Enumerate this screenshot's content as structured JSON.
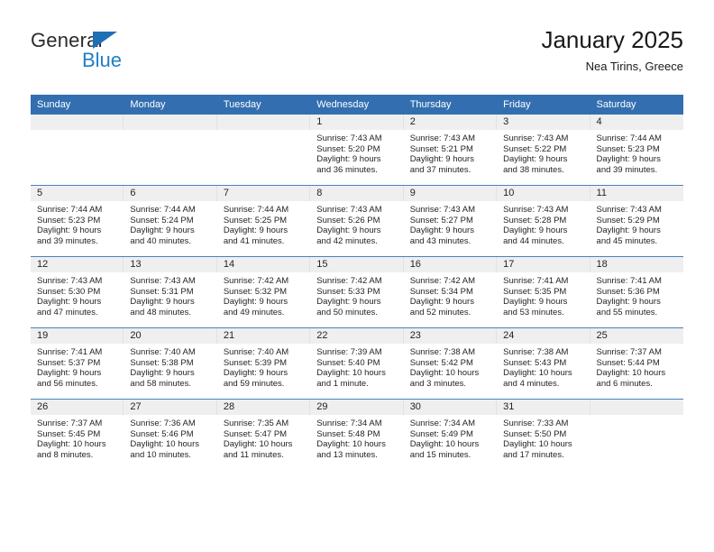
{
  "brand": {
    "name_part1": "General",
    "name_part2": "Blue",
    "triangle_color": "#1f6fb4",
    "blue_color": "#1f7fc4"
  },
  "header": {
    "title": "January 2025",
    "subtitle": "Nea Tirins, Greece"
  },
  "theme": {
    "header_blue": "#336fb0",
    "row_rule_blue": "#4a82bd",
    "day_strip_gray": "#efefef"
  },
  "weekday_headers": [
    "Sunday",
    "Monday",
    "Tuesday",
    "Wednesday",
    "Thursday",
    "Friday",
    "Saturday"
  ],
  "labels": {
    "sunrise_prefix": "Sunrise:",
    "sunset_prefix": "Sunset:",
    "daylight_prefix": "Daylight:"
  },
  "weeks": [
    [
      {
        "day": "",
        "empty": true
      },
      {
        "day": "",
        "empty": true
      },
      {
        "day": "",
        "empty": true
      },
      {
        "day": "1",
        "sunrise": "Sunrise: 7:43 AM",
        "sunset": "Sunset: 5:20 PM",
        "daylight_line1": "Daylight: 9 hours",
        "daylight_line2": "and 36 minutes."
      },
      {
        "day": "2",
        "sunrise": "Sunrise: 7:43 AM",
        "sunset": "Sunset: 5:21 PM",
        "daylight_line1": "Daylight: 9 hours",
        "daylight_line2": "and 37 minutes."
      },
      {
        "day": "3",
        "sunrise": "Sunrise: 7:43 AM",
        "sunset": "Sunset: 5:22 PM",
        "daylight_line1": "Daylight: 9 hours",
        "daylight_line2": "and 38 minutes."
      },
      {
        "day": "4",
        "sunrise": "Sunrise: 7:44 AM",
        "sunset": "Sunset: 5:23 PM",
        "daylight_line1": "Daylight: 9 hours",
        "daylight_line2": "and 39 minutes."
      }
    ],
    [
      {
        "day": "5",
        "sunrise": "Sunrise: 7:44 AM",
        "sunset": "Sunset: 5:23 PM",
        "daylight_line1": "Daylight: 9 hours",
        "daylight_line2": "and 39 minutes."
      },
      {
        "day": "6",
        "sunrise": "Sunrise: 7:44 AM",
        "sunset": "Sunset: 5:24 PM",
        "daylight_line1": "Daylight: 9 hours",
        "daylight_line2": "and 40 minutes."
      },
      {
        "day": "7",
        "sunrise": "Sunrise: 7:44 AM",
        "sunset": "Sunset: 5:25 PM",
        "daylight_line1": "Daylight: 9 hours",
        "daylight_line2": "and 41 minutes."
      },
      {
        "day": "8",
        "sunrise": "Sunrise: 7:43 AM",
        "sunset": "Sunset: 5:26 PM",
        "daylight_line1": "Daylight: 9 hours",
        "daylight_line2": "and 42 minutes."
      },
      {
        "day": "9",
        "sunrise": "Sunrise: 7:43 AM",
        "sunset": "Sunset: 5:27 PM",
        "daylight_line1": "Daylight: 9 hours",
        "daylight_line2": "and 43 minutes."
      },
      {
        "day": "10",
        "sunrise": "Sunrise: 7:43 AM",
        "sunset": "Sunset: 5:28 PM",
        "daylight_line1": "Daylight: 9 hours",
        "daylight_line2": "and 44 minutes."
      },
      {
        "day": "11",
        "sunrise": "Sunrise: 7:43 AM",
        "sunset": "Sunset: 5:29 PM",
        "daylight_line1": "Daylight: 9 hours",
        "daylight_line2": "and 45 minutes."
      }
    ],
    [
      {
        "day": "12",
        "sunrise": "Sunrise: 7:43 AM",
        "sunset": "Sunset: 5:30 PM",
        "daylight_line1": "Daylight: 9 hours",
        "daylight_line2": "and 47 minutes."
      },
      {
        "day": "13",
        "sunrise": "Sunrise: 7:43 AM",
        "sunset": "Sunset: 5:31 PM",
        "daylight_line1": "Daylight: 9 hours",
        "daylight_line2": "and 48 minutes."
      },
      {
        "day": "14",
        "sunrise": "Sunrise: 7:42 AM",
        "sunset": "Sunset: 5:32 PM",
        "daylight_line1": "Daylight: 9 hours",
        "daylight_line2": "and 49 minutes."
      },
      {
        "day": "15",
        "sunrise": "Sunrise: 7:42 AM",
        "sunset": "Sunset: 5:33 PM",
        "daylight_line1": "Daylight: 9 hours",
        "daylight_line2": "and 50 minutes."
      },
      {
        "day": "16",
        "sunrise": "Sunrise: 7:42 AM",
        "sunset": "Sunset: 5:34 PM",
        "daylight_line1": "Daylight: 9 hours",
        "daylight_line2": "and 52 minutes."
      },
      {
        "day": "17",
        "sunrise": "Sunrise: 7:41 AM",
        "sunset": "Sunset: 5:35 PM",
        "daylight_line1": "Daylight: 9 hours",
        "daylight_line2": "and 53 minutes."
      },
      {
        "day": "18",
        "sunrise": "Sunrise: 7:41 AM",
        "sunset": "Sunset: 5:36 PM",
        "daylight_line1": "Daylight: 9 hours",
        "daylight_line2": "and 55 minutes."
      }
    ],
    [
      {
        "day": "19",
        "sunrise": "Sunrise: 7:41 AM",
        "sunset": "Sunset: 5:37 PM",
        "daylight_line1": "Daylight: 9 hours",
        "daylight_line2": "and 56 minutes."
      },
      {
        "day": "20",
        "sunrise": "Sunrise: 7:40 AM",
        "sunset": "Sunset: 5:38 PM",
        "daylight_line1": "Daylight: 9 hours",
        "daylight_line2": "and 58 minutes."
      },
      {
        "day": "21",
        "sunrise": "Sunrise: 7:40 AM",
        "sunset": "Sunset: 5:39 PM",
        "daylight_line1": "Daylight: 9 hours",
        "daylight_line2": "and 59 minutes."
      },
      {
        "day": "22",
        "sunrise": "Sunrise: 7:39 AM",
        "sunset": "Sunset: 5:40 PM",
        "daylight_line1": "Daylight: 10 hours",
        "daylight_line2": "and 1 minute."
      },
      {
        "day": "23",
        "sunrise": "Sunrise: 7:38 AM",
        "sunset": "Sunset: 5:42 PM",
        "daylight_line1": "Daylight: 10 hours",
        "daylight_line2": "and 3 minutes."
      },
      {
        "day": "24",
        "sunrise": "Sunrise: 7:38 AM",
        "sunset": "Sunset: 5:43 PM",
        "daylight_line1": "Daylight: 10 hours",
        "daylight_line2": "and 4 minutes."
      },
      {
        "day": "25",
        "sunrise": "Sunrise: 7:37 AM",
        "sunset": "Sunset: 5:44 PM",
        "daylight_line1": "Daylight: 10 hours",
        "daylight_line2": "and 6 minutes."
      }
    ],
    [
      {
        "day": "26",
        "sunrise": "Sunrise: 7:37 AM",
        "sunset": "Sunset: 5:45 PM",
        "daylight_line1": "Daylight: 10 hours",
        "daylight_line2": "and 8 minutes."
      },
      {
        "day": "27",
        "sunrise": "Sunrise: 7:36 AM",
        "sunset": "Sunset: 5:46 PM",
        "daylight_line1": "Daylight: 10 hours",
        "daylight_line2": "and 10 minutes."
      },
      {
        "day": "28",
        "sunrise": "Sunrise: 7:35 AM",
        "sunset": "Sunset: 5:47 PM",
        "daylight_line1": "Daylight: 10 hours",
        "daylight_line2": "and 11 minutes."
      },
      {
        "day": "29",
        "sunrise": "Sunrise: 7:34 AM",
        "sunset": "Sunset: 5:48 PM",
        "daylight_line1": "Daylight: 10 hours",
        "daylight_line2": "and 13 minutes."
      },
      {
        "day": "30",
        "sunrise": "Sunrise: 7:34 AM",
        "sunset": "Sunset: 5:49 PM",
        "daylight_line1": "Daylight: 10 hours",
        "daylight_line2": "and 15 minutes."
      },
      {
        "day": "31",
        "sunrise": "Sunrise: 7:33 AM",
        "sunset": "Sunset: 5:50 PM",
        "daylight_line1": "Daylight: 10 hours",
        "daylight_line2": "and 17 minutes."
      },
      {
        "day": "",
        "empty": true
      }
    ]
  ]
}
